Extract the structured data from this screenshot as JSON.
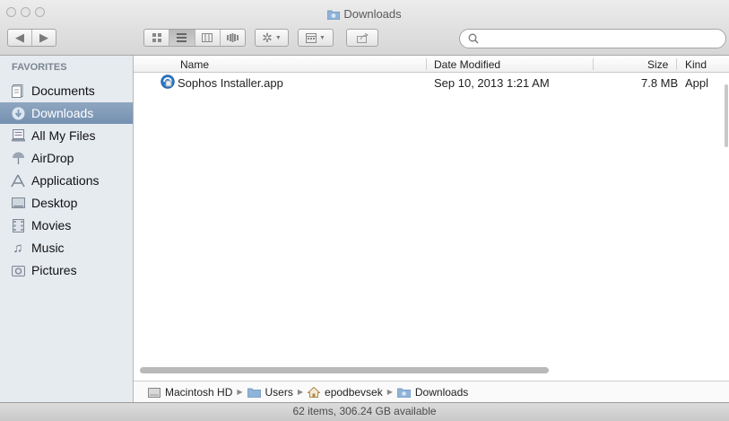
{
  "window": {
    "title": "Downloads"
  },
  "toolbar": {
    "back_icon": "back-arrow-icon",
    "forward_icon": "forward-arrow-icon",
    "views": [
      "icon-view",
      "list-view",
      "column-view",
      "cover-flow-view"
    ],
    "active_view": "list-view",
    "action_icon": "gear-icon",
    "arrange_icon": "arrange-icon",
    "share_icon": "share-icon",
    "search": {
      "value": "",
      "placeholder": ""
    }
  },
  "sidebar": {
    "heading": "FAVORITES",
    "items": [
      {
        "label": "Documents",
        "icon": "documents-icon"
      },
      {
        "label": "Downloads",
        "icon": "downloads-icon",
        "selected": true
      },
      {
        "label": "All My Files",
        "icon": "all-my-files-icon"
      },
      {
        "label": "AirDrop",
        "icon": "airdrop-icon"
      },
      {
        "label": "Applications",
        "icon": "applications-icon"
      },
      {
        "label": "Desktop",
        "icon": "desktop-icon"
      },
      {
        "label": "Movies",
        "icon": "movies-icon"
      },
      {
        "label": "Music",
        "icon": "music-icon"
      },
      {
        "label": "Pictures",
        "icon": "pictures-icon"
      }
    ]
  },
  "list": {
    "columns": [
      "Name",
      "Date Modified",
      "Size",
      "Kind"
    ],
    "rows": [
      {
        "name": "Sophos Installer.app",
        "date": "Sep 10, 2013 1:21 AM",
        "size": "7.8 MB",
        "kind": "Appl",
        "icon": "sophos-app-icon"
      }
    ]
  },
  "path": [
    "Macintosh HD",
    "Users",
    "epodbevsek",
    "Downloads"
  ],
  "status": "62 items, 306.24 GB available",
  "colors": {
    "selection": "#7f99b8",
    "sidebar_bg": "#e6ebf0"
  }
}
